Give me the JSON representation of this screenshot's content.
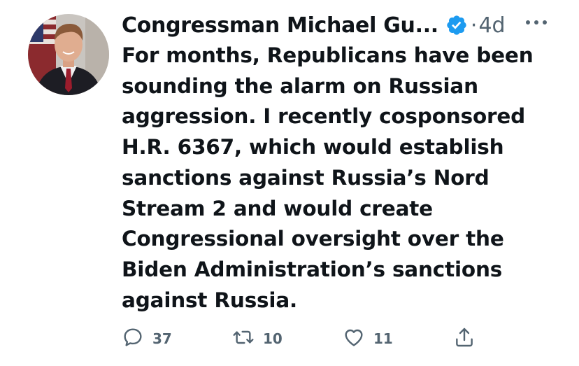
{
  "tweet": {
    "author_name": "Congressman Michael Gu...",
    "verified": true,
    "separator": "·",
    "time": "4d",
    "text": "For months, Republicans have been\nsounding the alarm on Russian\naggression. I recently cosponsored\nH.R. 6367, which would establish\nsanctions against Russia’s Nord\nStream 2 and would create\nCongressional oversight over the\nBiden Administration’s sanctions\nagainst Russia."
  },
  "actions": {
    "reply_count": "37",
    "retweet_count": "10",
    "like_count": "11"
  },
  "icons": {
    "verified": "verified-badge-icon",
    "more": "more-horizontal-icon",
    "reply": "reply-icon",
    "retweet": "retweet-icon",
    "like": "heart-icon",
    "share": "share-icon"
  },
  "colors": {
    "text_primary": "#0f1419",
    "text_secondary": "#536471",
    "verified_blue": "#1d9bf0"
  }
}
